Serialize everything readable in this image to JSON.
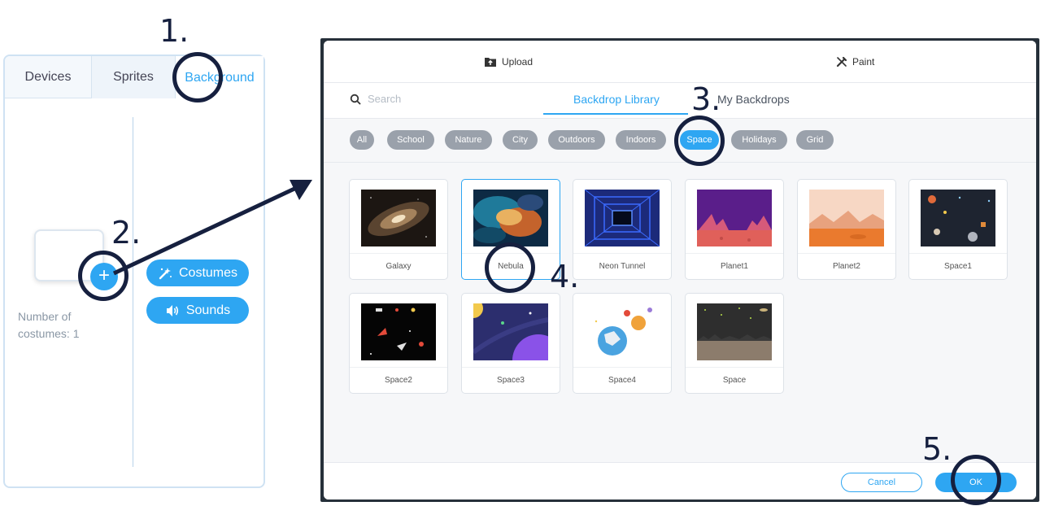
{
  "left_panel": {
    "tabs": [
      "Devices",
      "Sprites",
      "Background"
    ],
    "number_of_costumes": "Number of costumes: 1",
    "add_symbol": "+",
    "costumes_label": "Costumes",
    "sounds_label": "Sounds"
  },
  "dialog": {
    "upload_label": "Upload",
    "paint_label": "Paint",
    "search_placeholder": "Search",
    "tabs": [
      "Backdrop Library",
      "My Backdrops"
    ],
    "active_tab": "Backdrop Library",
    "categories": [
      "All",
      "School",
      "Nature",
      "City",
      "Outdoors",
      "Indoors",
      "Space",
      "Holidays",
      "Grid"
    ],
    "active_category": "Space",
    "backdrops": [
      "Galaxy",
      "Nebula",
      "Neon Tunnel",
      "Planet1",
      "Planet2",
      "Space1",
      "Space2",
      "Space3",
      "Space4",
      "Space"
    ],
    "selected_backdrop": "Nebula",
    "cancel_label": "Cancel",
    "ok_label": "OK"
  },
  "annotations": {
    "steps": [
      "1.",
      "2.",
      "3.",
      "4.",
      "5."
    ]
  },
  "colors": {
    "accent": "#2ea6f2",
    "annotation": "#16203f",
    "chip_inactive": "#9aa1ab"
  }
}
